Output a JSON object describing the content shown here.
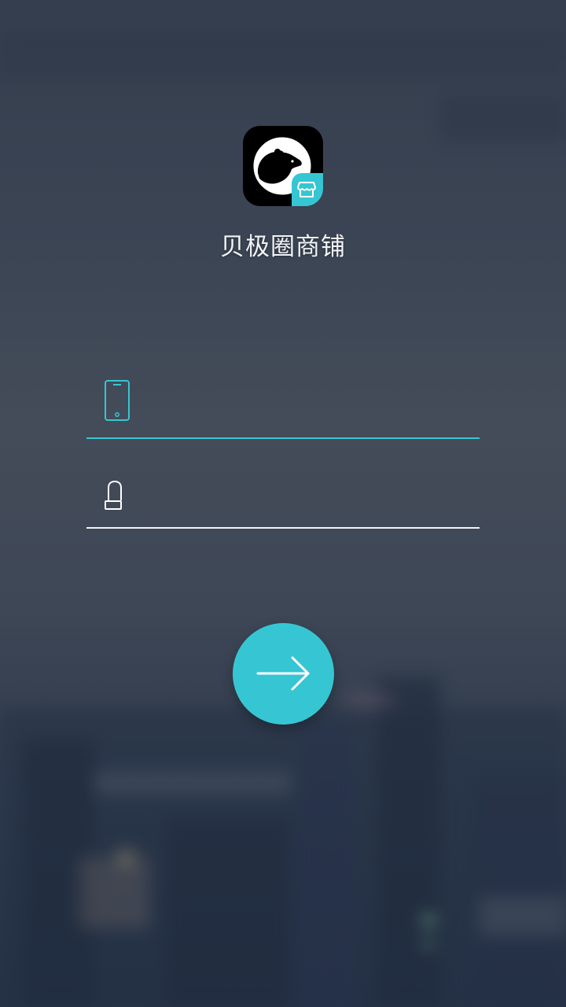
{
  "app": {
    "name": "贝极圈商铺",
    "logo_icon": "polar-bear-icon",
    "logo_badge_icon": "store-icon"
  },
  "login_form": {
    "phone_field": {
      "icon": "smartphone-icon",
      "value": "",
      "placeholder": ""
    },
    "password_field": {
      "icon": "lock-icon",
      "value": "",
      "placeholder": ""
    },
    "submit_button": {
      "icon": "arrow-right-icon"
    }
  },
  "colors": {
    "accent": "#36c6d3",
    "background": "#3b4554",
    "text": "#f2f4f6",
    "logo_background": "#000000"
  }
}
